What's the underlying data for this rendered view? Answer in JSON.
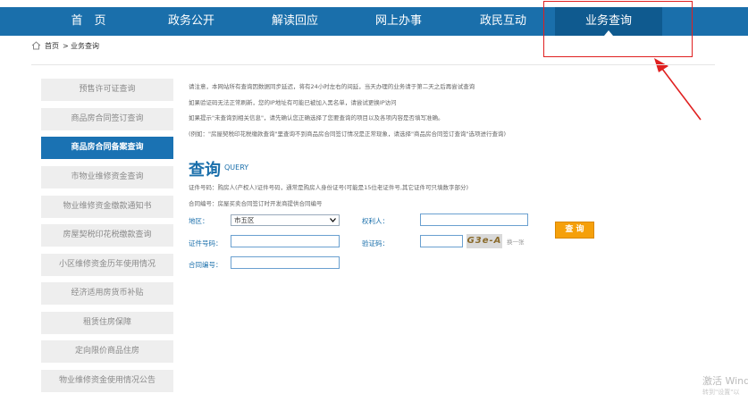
{
  "nav": {
    "items": [
      {
        "label": "首　页"
      },
      {
        "label": "政务公开"
      },
      {
        "label": "解读回应"
      },
      {
        "label": "网上办事"
      },
      {
        "label": "政民互动"
      },
      {
        "label": "业务查询"
      }
    ],
    "active_index": 5
  },
  "breadcrumb": {
    "home": "首页",
    "separator": ">",
    "current": "业务查询"
  },
  "sidebar": {
    "items": [
      {
        "label": "预售许可证查询"
      },
      {
        "label": "商品房合同签订查询"
      },
      {
        "label": "商品房合同备案查询"
      },
      {
        "label": "市物业维修资金查询"
      },
      {
        "label": "物业维修资金缴款通知书"
      },
      {
        "label": "房屋契税印花税缴款查询"
      },
      {
        "label": "小区维修资金历年使用情况"
      },
      {
        "label": "经济适用房货币补贴"
      },
      {
        "label": "租赁住房保障"
      },
      {
        "label": "定向限价商品住房"
      },
      {
        "label": "物业维修资金使用情况公告"
      }
    ],
    "active_index": 2
  },
  "notices": [
    "请注意，本网站所有查询因数据同步延迟，将有24小时左右的间延，当天办理的业务请于第二天之后再尝试查询",
    "如果验证码无法正常刷新，您的IP地址有可能已被加入黑名单，请尝试更换IP访问",
    "如果提示\"未查询到相关信息\"，请先确认您正确选择了您要查询的项目以及各项内容是否填写准确。",
    "(例如：\"房屋契税印花税缴款查询\"里查询不到商品房合同签订情况是正常现象，请选择\"商品房合同签订查询\"选项进行查询)"
  ],
  "query": {
    "title": "查询",
    "subtitle": "QUERY",
    "hints": [
      "证件号码：购房人(产权人)证件号码，通常是购房人身份证号(可能是15位老证件号,其它证件可只填数字部分)",
      "合同编号：房屋买卖合同签订时开发商提供合同编号"
    ],
    "fields": {
      "district_label": "地区：",
      "district_value": "市五区",
      "owner_label": "权利人：",
      "owner_value": "",
      "id_label": "证件号码：",
      "id_value": "",
      "captcha_label": "验证码：",
      "captcha_value": "",
      "contract_label": "合同编号：",
      "contract_value": ""
    },
    "captcha_text": "G3e-A",
    "refresh_label": "换一张",
    "submit_label": "查 询"
  },
  "watermark": {
    "line1": "激活 Wind",
    "line2": "转到\"设置\"以"
  },
  "colors": {
    "nav_bg": "#1a6fab",
    "sidebar_active": "#1a72b3",
    "button_orange": "#f5a00a",
    "annotation_red": "#e02020"
  }
}
